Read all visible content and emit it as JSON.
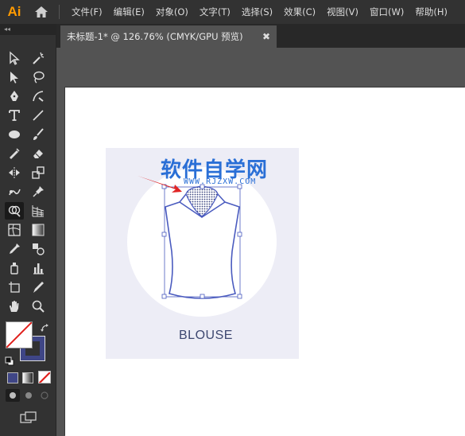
{
  "app": {
    "logo_text": "Ai"
  },
  "menu": [
    "文件(F)",
    "编辑(E)",
    "对象(O)",
    "文字(T)",
    "选择(S)",
    "效果(C)",
    "视图(V)",
    "窗口(W)",
    "帮助(H)"
  ],
  "toolbar": {
    "collapse_glyph": "◂◂"
  },
  "document": {
    "tab_title": "未标题-1* @ 126.76% (CMYK/GPU 预览)",
    "close_glyph": "✖"
  },
  "artwork": {
    "label": "BLOUSE",
    "watermark": "软件自学网",
    "watermark_url": "WWW.RJZXW.COM"
  },
  "colors": {
    "accent_orange": "#ff9a00",
    "illustration_bg": "#ededf6",
    "stroke_blue": "#4a5bbf",
    "label_color": "#3d4770",
    "watermark": "#2a6fd6"
  }
}
